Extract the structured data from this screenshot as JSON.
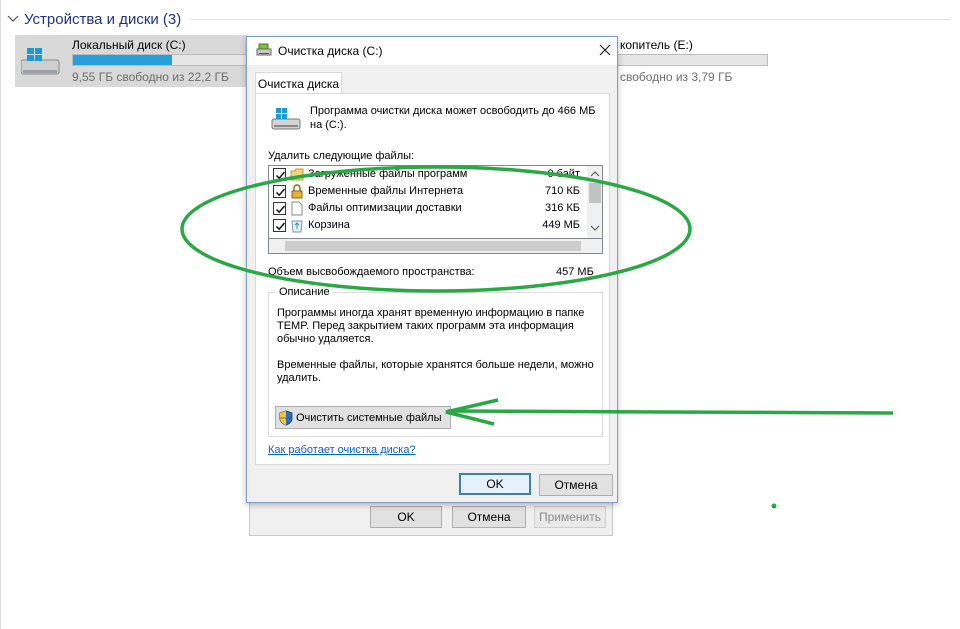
{
  "explorer": {
    "group_title": "Устройства и диски (3)",
    "drive_c": {
      "name": "Локальный диск (C:)",
      "free_text": "9,55 ГБ свободно из 22,2 ГБ",
      "used_fraction": 0.57
    },
    "drive_e": {
      "name": "копитель (E:)",
      "free_text": "свободно из 3,79 ГБ"
    }
  },
  "properties": {
    "ok_label": "OK",
    "cancel_label": "Отмена",
    "apply_label": "Применить"
  },
  "dialog": {
    "title": "Очистка диска  (C:)",
    "tab_label": "Очистка диска",
    "intro_text": "Программа очистки диска может освободить до 466 МБ на  (C:).",
    "delete_label": "Удалить следующие файлы:",
    "files": [
      {
        "name": "Загруженные файлы программ",
        "size": "0 байт",
        "checked": true,
        "icon": "folder-icon"
      },
      {
        "name": "Временные файлы Интернета",
        "size": "710 КБ",
        "checked": true,
        "icon": "lock-icon"
      },
      {
        "name": "Файлы оптимизации доставки",
        "size": "316 КБ",
        "checked": true,
        "icon": "file-icon"
      },
      {
        "name": "Корзина",
        "size": "449 МБ",
        "checked": true,
        "icon": "recycle-bin-icon"
      }
    ],
    "space_label": "Объем высвобождаемого пространства:",
    "space_value": "457 МБ",
    "description_legend": "Описание",
    "description_text_1": "Программы иногда хранят временную информацию в папке TEMP. Перед закрытием таких программ эта информация обычно удаляется.",
    "description_text_2": "Временные файлы, которые хранятся больше недели, можно удалить.",
    "cleanup_system_label": "Очистить системные файлы",
    "how_link": "Как работает очистка диска?",
    "ok_label": "OK",
    "cancel_label": "Отмена"
  },
  "colors": {
    "annotation_green": "#2aa845",
    "drive_bar": "#26a0da",
    "link": "#0066cc"
  }
}
